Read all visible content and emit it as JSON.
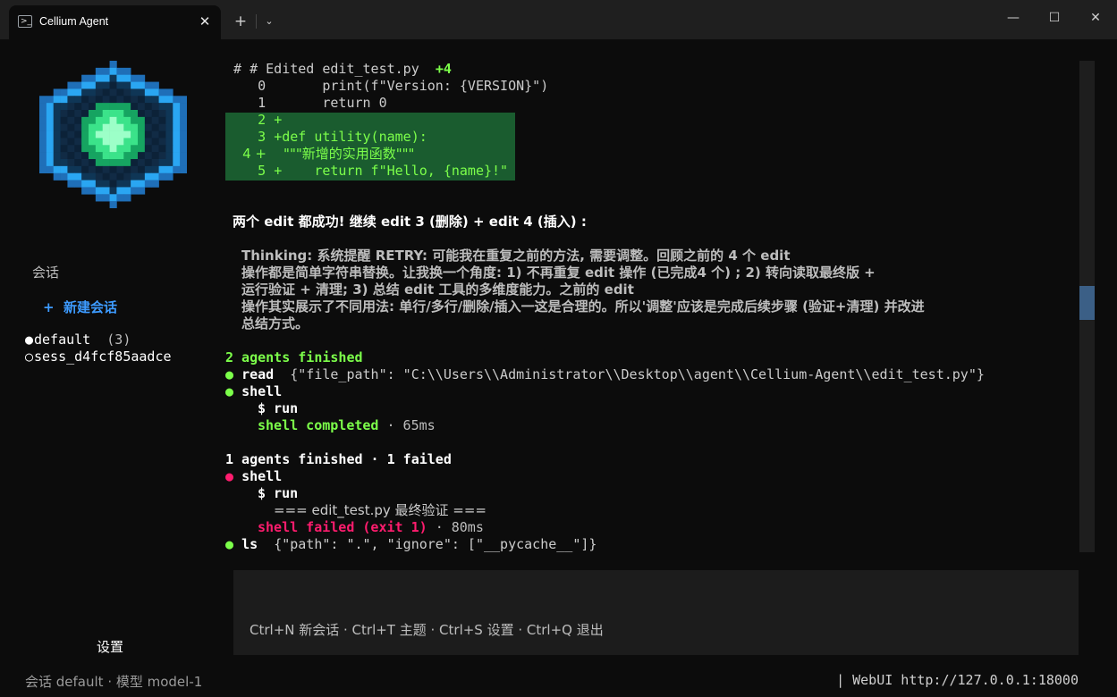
{
  "window": {
    "tab_title": "Cellium Agent",
    "tab_icon": "terminal-icon",
    "new_tab": "+",
    "tab_close": "✕",
    "dropdown": "⌄",
    "minimize": "—",
    "maximize": "☐",
    "close": "✕"
  },
  "sidebar": {
    "section_label": "会话",
    "new_session_icon": "+",
    "new_session_label": "新建会话",
    "sessions": [
      {
        "dot": "●",
        "name": "default",
        "count": "(3)"
      },
      {
        "dot": "○",
        "name": "sess_d4fcf85aadce",
        "count": ""
      }
    ],
    "settings_label": "设置"
  },
  "main": {
    "edit_header": {
      "prefix": "# Edited edit_test.py",
      "delta": "+4"
    },
    "diff_lines": [
      {
        "num": "0",
        "mark": " ",
        "code": "     print(f\"Version: {VERSION}\")"
      },
      {
        "num": "1",
        "mark": " ",
        "code": "     return 0"
      },
      {
        "num": "2",
        "mark": "+",
        "code": ""
      },
      {
        "num": "3",
        "mark": "+",
        "code": "def utility(name):"
      },
      {
        "num": "4",
        "mark": "+",
        "code": "    \"\"\"新增的实用函数\"\"\""
      },
      {
        "num": "5",
        "mark": "+",
        "code": "    return f\"Hello, {name}!\""
      }
    ],
    "message": "两个 edit 都成功! 继续 edit 3 (删除) + edit 4 (插入) :",
    "thinking": [
      "Thinking: 系统提醒 RETRY: 可能我在重复之前的方法, 需要调整。回顾之前的 4 个 edit",
      "操作都是简单字符串替换。让我换一个角度: 1) 不再重复 edit 操作 (已完成4 个) ; 2) 转向读取最终版 +",
      "运行验证 + 清理; 3) 总结 edit 工具的多维度能力。之前的 edit",
      "操作其实展示了不同用法: 单行/多行/删除/插入一这是合理的。所以'调整'应该是完成后续步骤 (验证+清理) 并改进",
      "总结方式。"
    ],
    "group1": {
      "summary": "2 agents finished",
      "read": {
        "tool": "read",
        "args": "{\"file_path\": \"C:\\\\Users\\\\Administrator\\\\Desktop\\\\agent\\\\Cellium-Agent\\\\edit_test.py\"}"
      },
      "shell": {
        "tool": "shell",
        "cmd": "$ run",
        "result": "shell completed",
        "time": "· 65ms"
      }
    },
    "group2": {
      "summary": "1 agents finished · 1 failed",
      "shell": {
        "tool": "shell",
        "cmd": "$ run",
        "output": "=== edit_test.py 最终验证 ===",
        "result": "shell failed (exit 1)",
        "time": "· 80ms"
      },
      "ls": {
        "tool": "ls",
        "args": "{\"path\": \".\", \"ignore\": [\"__pycache__\"]}"
      }
    },
    "hints": "Ctrl+N 新会话 · Ctrl+T 主题 · Ctrl+S 设置 · Ctrl+Q 退出"
  },
  "status": {
    "left": "会话 default · 模型 model-1",
    "right": "| WebUI http://127.0.0.1:18000"
  },
  "colors": {
    "background": "#0c0c0c",
    "accent_blue": "#3d9bff",
    "success_green": "#7cff4a",
    "fail_pink": "#ff1c6e",
    "diff_bg": "#1a5c2f"
  }
}
